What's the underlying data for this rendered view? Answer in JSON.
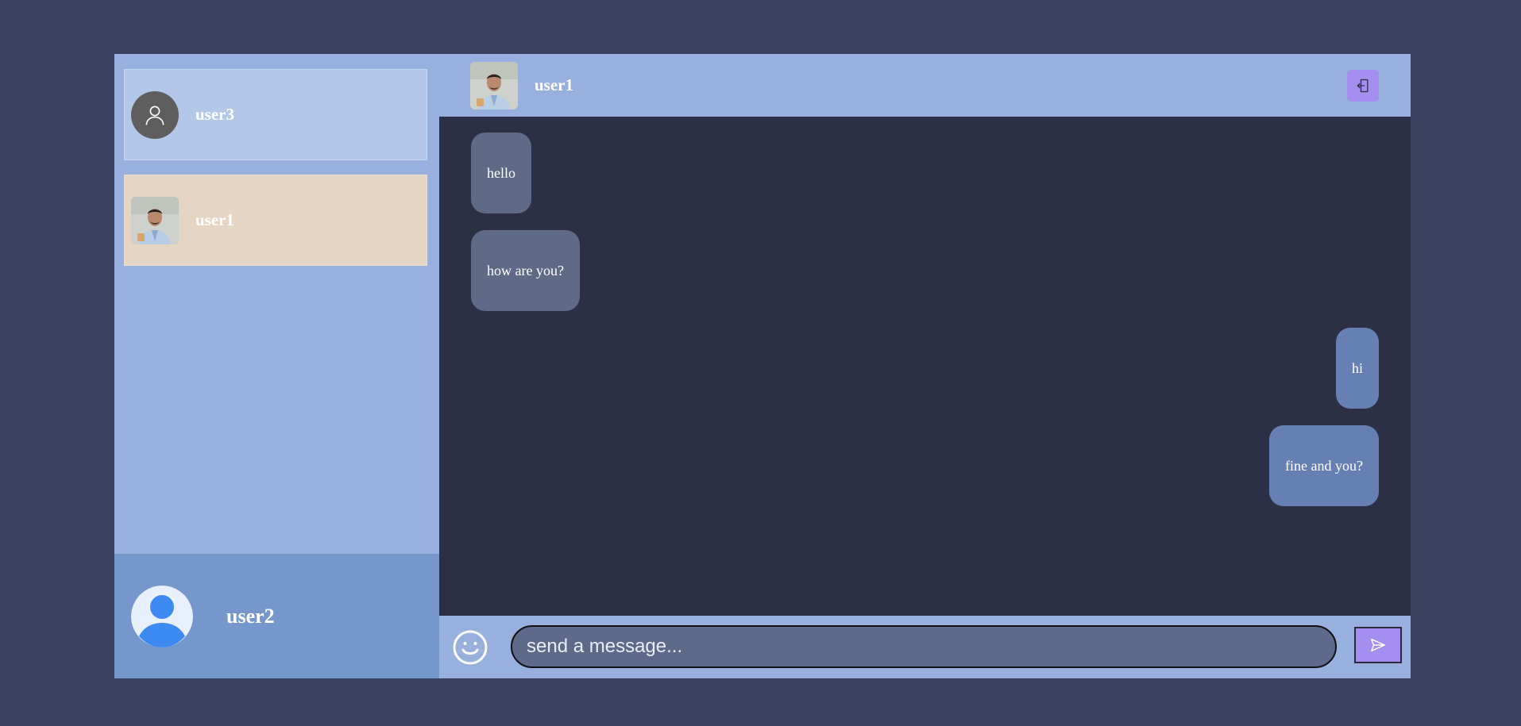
{
  "sidebar": {
    "contacts": [
      {
        "name": "user3",
        "avatar": "default-user-icon"
      },
      {
        "name": "user1",
        "avatar": "user-photo"
      }
    ],
    "current_user": {
      "name": "user2",
      "avatar": "default-user-icon"
    }
  },
  "chat": {
    "header": {
      "name": "user1",
      "avatar": "user-photo",
      "action_icon": "logout-icon"
    },
    "messages": [
      {
        "text": "hello",
        "direction": "incoming"
      },
      {
        "text": "how are you?",
        "direction": "incoming"
      },
      {
        "text": "hi",
        "direction": "outgoing"
      },
      {
        "text": "fine and you?",
        "direction": "outgoing"
      }
    ],
    "composer": {
      "placeholder": "send a message...",
      "emoji_icon": "smiley-icon",
      "send_icon": "send-icon"
    }
  },
  "colors": {
    "background": "#3b405c",
    "sidebar": "#97b0dd",
    "active_contact": "#e5d5c2",
    "chat_area": "#2b3045",
    "incoming_bubble": "#5e6a86",
    "outgoing_bubble": "#6680b3",
    "accent": "#a48ef0"
  }
}
